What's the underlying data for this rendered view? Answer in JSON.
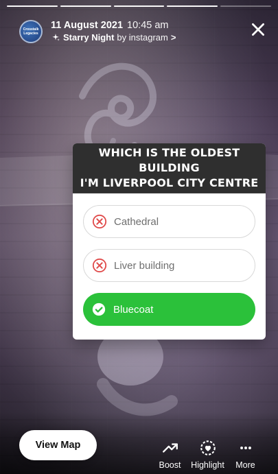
{
  "story": {
    "progress_segments": [
      1,
      1,
      1,
      1,
      0
    ]
  },
  "header": {
    "avatar_text": "Crosstalk\nLegacies",
    "date": "11 August 2021",
    "time": "10:45 am",
    "filter_name": "Starry Night",
    "by_text": "by instagram",
    "chevron": ">",
    "icons": {
      "sparkle": "sparkle-icon",
      "close": "close-icon"
    }
  },
  "poll": {
    "question": "WHICH IS THE OLDEST BUILDING\nI'M LIVERPOOL CITY CENTRE",
    "options": [
      {
        "label": "Cathedral",
        "status": "wrong"
      },
      {
        "label": "Liver building",
        "status": "wrong"
      },
      {
        "label": "Bluecoat",
        "status": "correct"
      }
    ],
    "colors": {
      "header_bg": "#2f2f2f",
      "correct_bg": "#2bc13a",
      "wrong_icon": "#e04b4b"
    }
  },
  "bottom": {
    "view_map_label": "View Map",
    "actions": [
      {
        "label": "Boost",
        "icon": "boost-icon"
      },
      {
        "label": "Highlight",
        "icon": "highlight-icon"
      },
      {
        "label": "More",
        "icon": "more-icon"
      }
    ]
  }
}
